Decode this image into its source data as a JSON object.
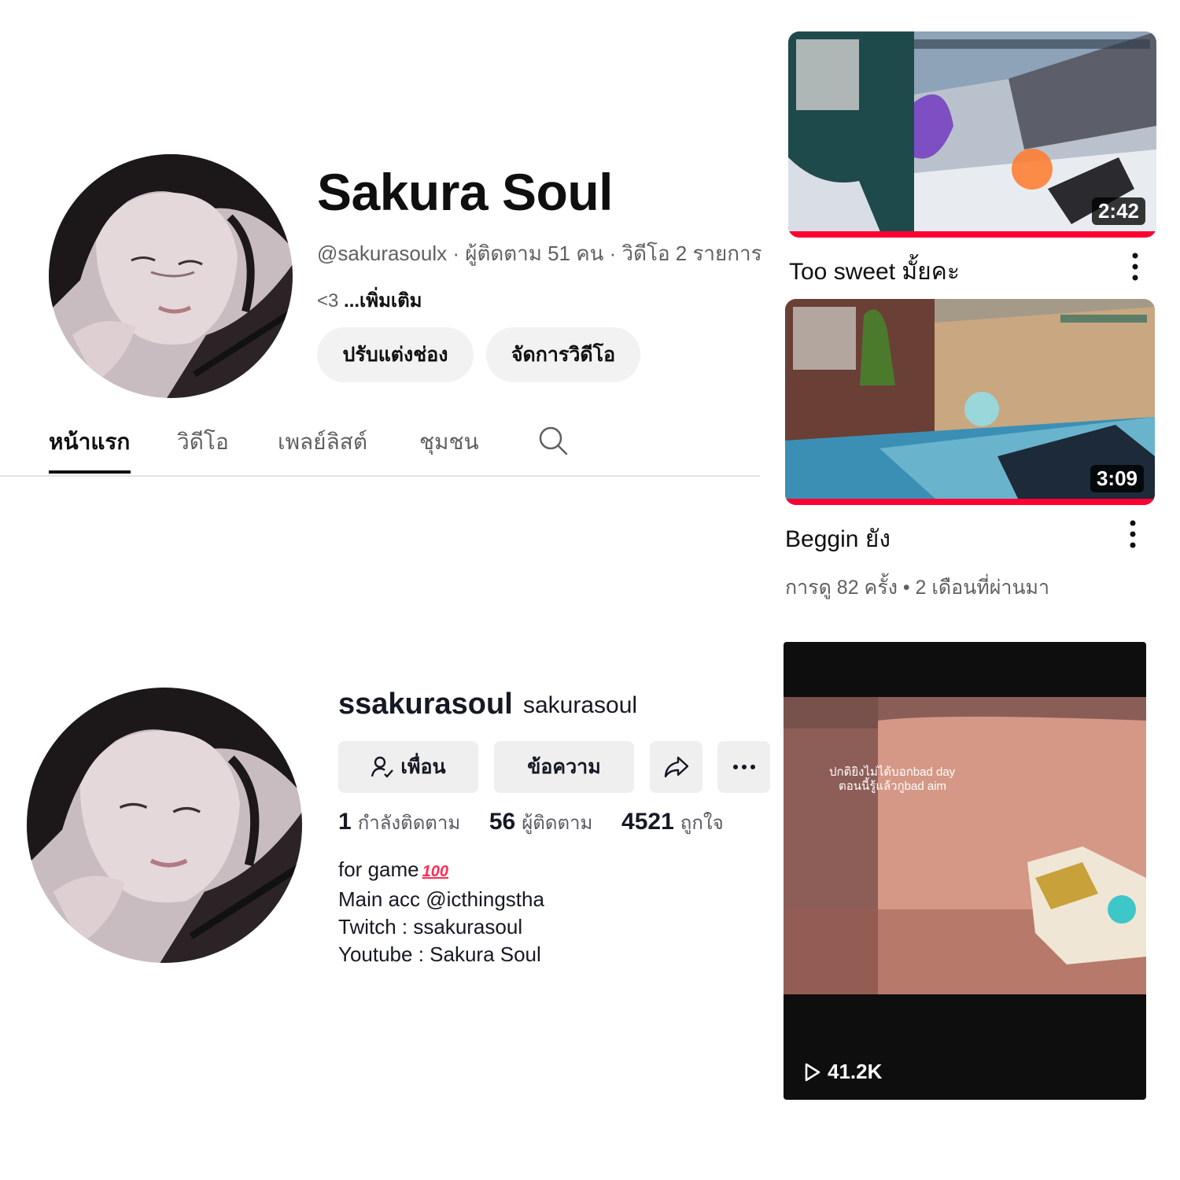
{
  "youtube": {
    "channel_name": "Sakura Soul",
    "meta_line": "@sakurasoulx · ผู้ติดตาม 51 คน · วิดีโอ 2 รายการ",
    "description": "<3",
    "more_label": "...เพิ่มเติม",
    "buttons": {
      "customize": "ปรับแต่งช่อง",
      "manage_videos": "จัดการวิดีโอ"
    },
    "tabs": [
      "หน้าแรก",
      "วิดีโอ",
      "เพลย์ลิสต์",
      "ชุมชน"
    ],
    "active_tab": "หน้าแรก",
    "videos": [
      {
        "title": "Too sweet มั้ยคะ",
        "duration": "2:42"
      },
      {
        "title": "Beggin ยัง",
        "duration": "3:09",
        "meta": "การดู 82 ครั้ง • 2 เดือนที่ผ่านมา"
      }
    ],
    "colors": {
      "progress": "#ff0033",
      "text": "#0f0f0f",
      "secondary": "#606060",
      "pill": "#f2f2f2"
    }
  },
  "tiktok": {
    "handle": "ssakurasoul",
    "nickname": "sakurasoul",
    "buttons": {
      "friends": "เพื่อน",
      "message": "ข้อความ"
    },
    "stats": [
      {
        "value": "1",
        "label": "กำลังติดตาม"
      },
      {
        "value": "56",
        "label": "ผู้ติดตาม"
      },
      {
        "value": "4521",
        "label": "ถูกใจ"
      }
    ],
    "bio": {
      "line1": "for game",
      "emoji": "100",
      "line2": "Main acc @icthingstha",
      "line3": "Twitch : ssakurasoul",
      "line4": "Youtube : Sakura Soul"
    },
    "video": {
      "views": "41.2K",
      "overlay_text_1": "ปกติยิงไม่ได้บอกbad day",
      "overlay_text_2": "ตอนนี้รู้แล้วกูbad aim"
    }
  }
}
